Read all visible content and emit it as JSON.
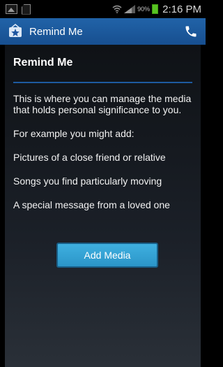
{
  "status_bar": {
    "icons": [
      "image-icon",
      "sd-card-icon",
      "wifi-icon",
      "signal-icon",
      "battery-icon"
    ],
    "battery_percent": "90%",
    "time": "2:16 PM"
  },
  "app_bar": {
    "title": "Remind Me",
    "logo_icon": "star-logo-icon",
    "call_icon": "phone-icon",
    "color": "#1c5aa0"
  },
  "content": {
    "title": "Remind Me",
    "description": "This is where you can manage the media that holds personal significance to you.",
    "example_intro": "For example you might add:",
    "examples": [
      "Pictures of a close friend or relative",
      "Songs you find particularly moving",
      "A special message from a loved one"
    ],
    "add_media_label": "Add Media",
    "accent": "#35a4d6"
  }
}
